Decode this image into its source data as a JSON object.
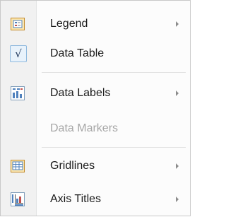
{
  "menu": {
    "items": [
      {
        "label": "Legend",
        "icon": "legend-icon",
        "has_submenu": true,
        "enabled": true
      },
      {
        "label": "Data Table",
        "icon": "checkmark-icon",
        "checked": true,
        "has_submenu": false,
        "enabled": true
      },
      {
        "label": "Data Labels",
        "icon": "data-labels-icon",
        "has_submenu": true,
        "enabled": true
      },
      {
        "label": "Data Markers",
        "icon": null,
        "has_submenu": false,
        "enabled": false
      },
      {
        "label": "Gridlines",
        "icon": "gridlines-icon",
        "has_submenu": true,
        "enabled": true
      },
      {
        "label": "Axis Titles",
        "icon": "axis-titles-icon",
        "has_submenu": true,
        "enabled": true
      }
    ],
    "checkmark_glyph": "√"
  },
  "colors": {
    "accent": "#4f81bd",
    "disabled_text": "#a6a6a6",
    "check_highlight": "#e8f2fb"
  }
}
